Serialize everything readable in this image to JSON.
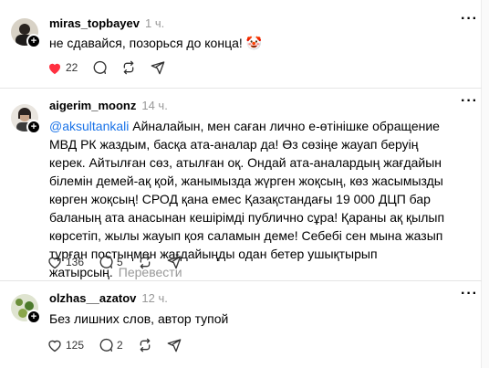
{
  "posts": [
    {
      "username": "miras_topbayev",
      "time": "1 ч.",
      "text": "не сдавайся, позорься до конца! 🤡",
      "likes": "22",
      "liked": true,
      "comments": "",
      "translate": ""
    },
    {
      "username": "aigerim_moonz",
      "time": "14 ч.",
      "mention": "@aksultankali",
      "text": " Айналайын, мен саған лично е-өтінішке обращение МВД РК жаздым, басқа ата-аналар да! Өз сөзіңе жауап беруің керек. Айтылған сөз, атылған оқ. Ондай ата-аналардың жағдайын білемін демей-ақ қой, жанымызда жүрген жоқсың, көз жасымызды көрген жоқсың! СРОД қана емес Қазақстандағы 19 000 ДЦП бар баланың ата анасынан кешірімді публично сұра! Қараны ақ қылып көрсетіп, жылы жауып қоя саламын деме! Себебі сен мына жазып тұрған постыңмен жағдайыңды одан бетер ушықтырып жатырсың.",
      "translate": "Перевести",
      "likes": "136",
      "comments": "5"
    },
    {
      "username": "olzhas__azatov",
      "time": "12 ч.",
      "text": "Без лишних слов, автор тупой",
      "likes": "125",
      "comments": "2"
    }
  ],
  "colors": {
    "like_active": "#ff3040",
    "mention": "#1a73e8",
    "muted": "#999999"
  },
  "icons": [
    "heart-icon",
    "comment-icon",
    "repost-icon",
    "share-icon",
    "more-icon",
    "follow-plus-icon"
  ]
}
